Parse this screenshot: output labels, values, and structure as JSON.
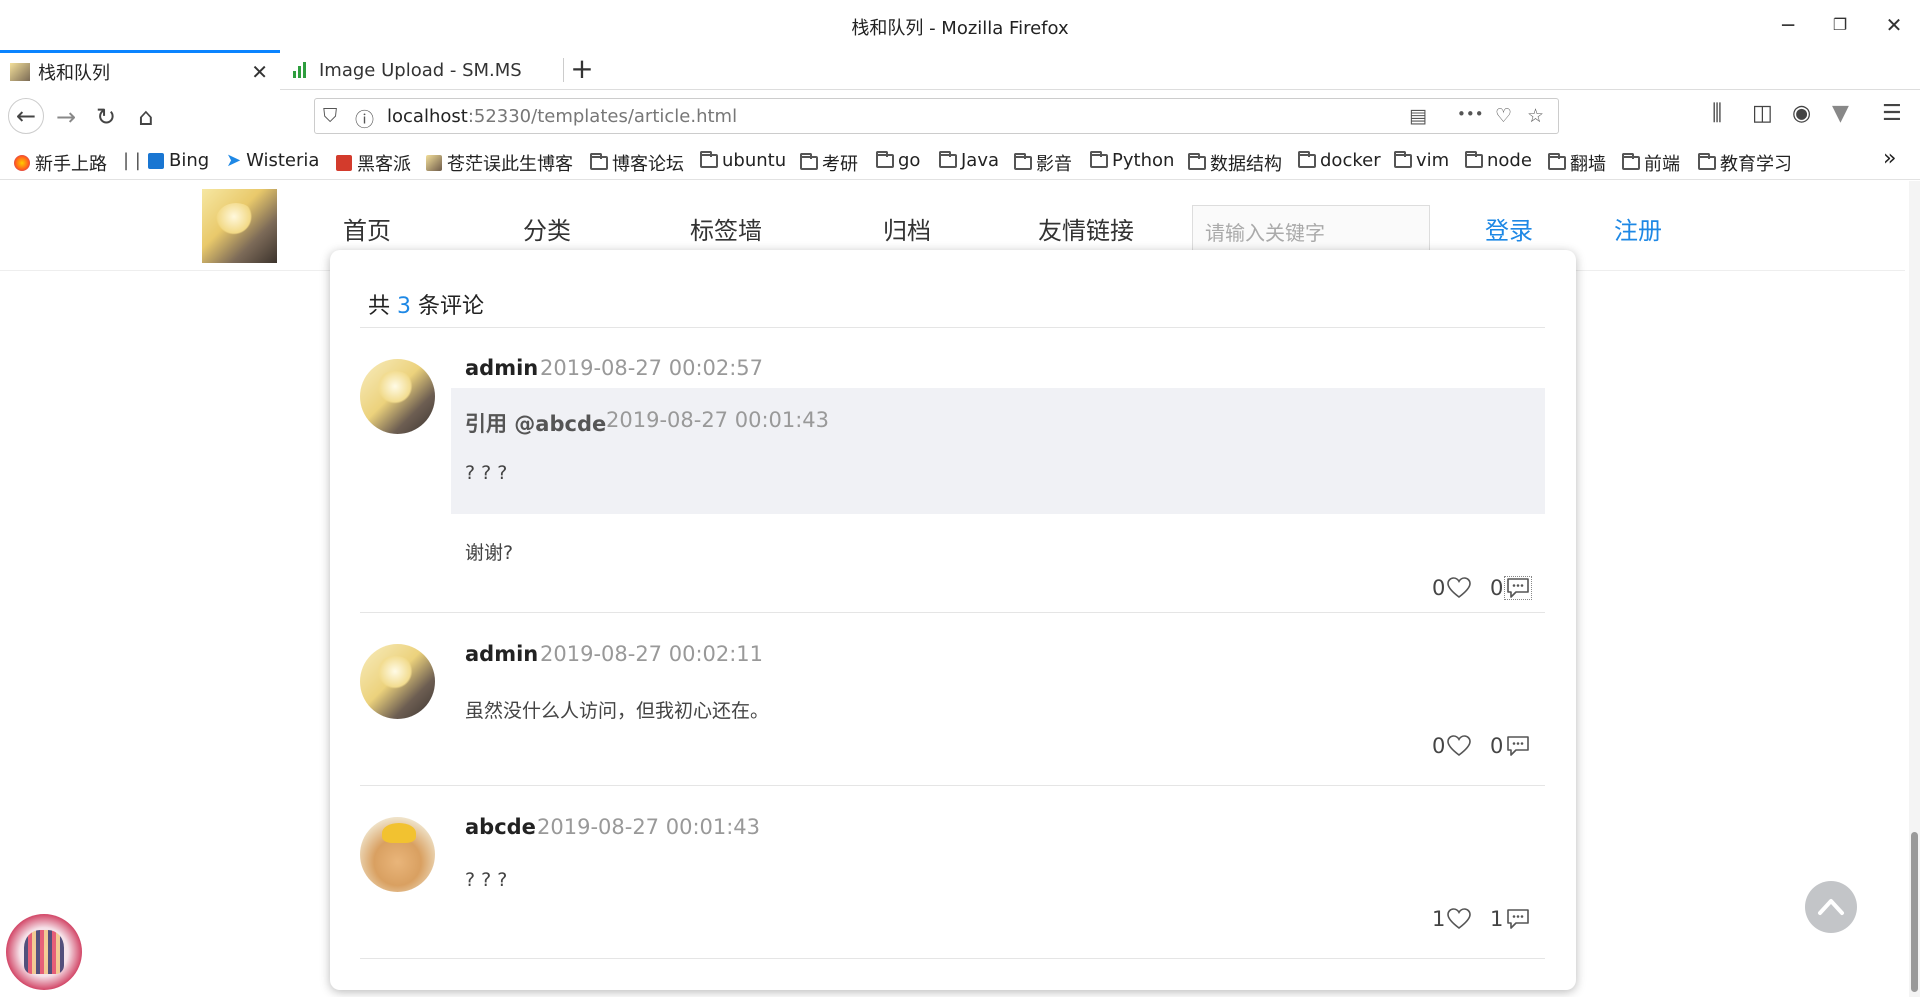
{
  "window": {
    "title": "栈和队列 - Mozilla Firefox",
    "minimize": "─",
    "restore": "❐",
    "close": "✕"
  },
  "tabs": [
    {
      "label": "栈和队列",
      "active": true
    },
    {
      "label": "Image Upload - SM.MS",
      "active": false
    }
  ],
  "tab_close": "✕",
  "newtab": "+",
  "nav": {
    "url_host": "localhost",
    "url_path": ":52330/templates/article.html",
    "more": "•••"
  },
  "bookmarks": [
    {
      "label": "新手上路",
      "icon": "firefox-icon"
    },
    {
      "label": "Bing",
      "icon": "bing-icon"
    },
    {
      "label": "Wisteria",
      "icon": "arrow-icon"
    },
    {
      "label": "黑客派",
      "icon": "hacpai-icon"
    },
    {
      "label": "苍茫误此生博客",
      "icon": "blog-icon"
    },
    {
      "label": "博客论坛",
      "icon": "folder-icon"
    },
    {
      "label": "ubuntu",
      "icon": "folder-icon"
    },
    {
      "label": "考研",
      "icon": "folder-icon"
    },
    {
      "label": "go",
      "icon": "folder-icon"
    },
    {
      "label": "Java",
      "icon": "folder-icon"
    },
    {
      "label": "影音",
      "icon": "folder-icon"
    },
    {
      "label": "Python",
      "icon": "folder-icon"
    },
    {
      "label": "数据结构",
      "icon": "folder-icon"
    },
    {
      "label": "docker",
      "icon": "folder-icon"
    },
    {
      "label": "vim",
      "icon": "folder-icon"
    },
    {
      "label": "node",
      "icon": "folder-icon"
    },
    {
      "label": "翻墙",
      "icon": "folder-icon"
    },
    {
      "label": "前端",
      "icon": "folder-icon"
    },
    {
      "label": "教育学习",
      "icon": "folder-icon"
    }
  ],
  "bookmarks_overflow": "»",
  "site": {
    "nav": [
      "首页",
      "分类",
      "标签墙",
      "归档",
      "友情链接"
    ],
    "search_placeholder": "请输入关键字",
    "login": "登录",
    "register": "注册"
  },
  "comments_header": {
    "prefix": "共",
    "count": "3",
    "suffix": "条评论"
  },
  "comments": [
    {
      "user": "admin",
      "time": "2019-08-27 00:02:57",
      "quote": {
        "label": "引用 @abcde",
        "time": "2019-08-27 00:01:43",
        "text": "? ? ?"
      },
      "text": "谢谢?",
      "likes": "0",
      "replies": "0"
    },
    {
      "user": "admin",
      "time": "2019-08-27 00:02:11",
      "text": "虽然没什么人访问，但我初心还在。",
      "likes": "0",
      "replies": "0"
    },
    {
      "user": "abcde",
      "time": "2019-08-27 00:01:43",
      "text": "? ? ?",
      "likes": "1",
      "replies": "1"
    }
  ],
  "colors": {
    "accent": "#1e88e5",
    "tab_highlight": "#0a84ff",
    "quote_bg": "#f0f1f5"
  }
}
